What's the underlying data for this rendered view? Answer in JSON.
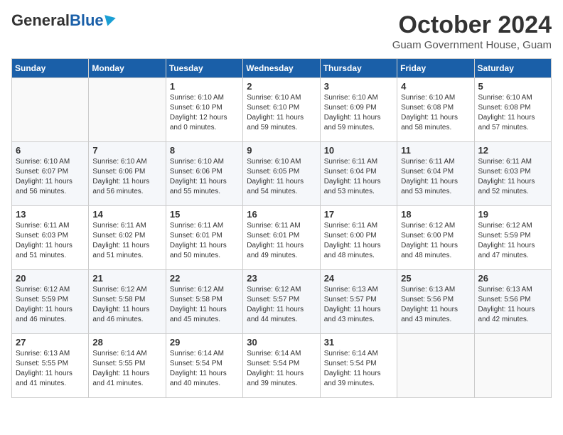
{
  "header": {
    "logo_general": "General",
    "logo_blue": "Blue",
    "month_title": "October 2024",
    "subtitle": "Guam Government House, Guam"
  },
  "weekdays": [
    "Sunday",
    "Monday",
    "Tuesday",
    "Wednesday",
    "Thursday",
    "Friday",
    "Saturday"
  ],
  "weeks": [
    [
      {
        "day": "",
        "info": ""
      },
      {
        "day": "",
        "info": ""
      },
      {
        "day": "1",
        "info": "Sunrise: 6:10 AM\nSunset: 6:10 PM\nDaylight: 12 hours\nand 0 minutes."
      },
      {
        "day": "2",
        "info": "Sunrise: 6:10 AM\nSunset: 6:10 PM\nDaylight: 11 hours\nand 59 minutes."
      },
      {
        "day": "3",
        "info": "Sunrise: 6:10 AM\nSunset: 6:09 PM\nDaylight: 11 hours\nand 59 minutes."
      },
      {
        "day": "4",
        "info": "Sunrise: 6:10 AM\nSunset: 6:08 PM\nDaylight: 11 hours\nand 58 minutes."
      },
      {
        "day": "5",
        "info": "Sunrise: 6:10 AM\nSunset: 6:08 PM\nDaylight: 11 hours\nand 57 minutes."
      }
    ],
    [
      {
        "day": "6",
        "info": "Sunrise: 6:10 AM\nSunset: 6:07 PM\nDaylight: 11 hours\nand 56 minutes."
      },
      {
        "day": "7",
        "info": "Sunrise: 6:10 AM\nSunset: 6:06 PM\nDaylight: 11 hours\nand 56 minutes."
      },
      {
        "day": "8",
        "info": "Sunrise: 6:10 AM\nSunset: 6:06 PM\nDaylight: 11 hours\nand 55 minutes."
      },
      {
        "day": "9",
        "info": "Sunrise: 6:10 AM\nSunset: 6:05 PM\nDaylight: 11 hours\nand 54 minutes."
      },
      {
        "day": "10",
        "info": "Sunrise: 6:11 AM\nSunset: 6:04 PM\nDaylight: 11 hours\nand 53 minutes."
      },
      {
        "day": "11",
        "info": "Sunrise: 6:11 AM\nSunset: 6:04 PM\nDaylight: 11 hours\nand 53 minutes."
      },
      {
        "day": "12",
        "info": "Sunrise: 6:11 AM\nSunset: 6:03 PM\nDaylight: 11 hours\nand 52 minutes."
      }
    ],
    [
      {
        "day": "13",
        "info": "Sunrise: 6:11 AM\nSunset: 6:03 PM\nDaylight: 11 hours\nand 51 minutes."
      },
      {
        "day": "14",
        "info": "Sunrise: 6:11 AM\nSunset: 6:02 PM\nDaylight: 11 hours\nand 51 minutes."
      },
      {
        "day": "15",
        "info": "Sunrise: 6:11 AM\nSunset: 6:01 PM\nDaylight: 11 hours\nand 50 minutes."
      },
      {
        "day": "16",
        "info": "Sunrise: 6:11 AM\nSunset: 6:01 PM\nDaylight: 11 hours\nand 49 minutes."
      },
      {
        "day": "17",
        "info": "Sunrise: 6:11 AM\nSunset: 6:00 PM\nDaylight: 11 hours\nand 48 minutes."
      },
      {
        "day": "18",
        "info": "Sunrise: 6:12 AM\nSunset: 6:00 PM\nDaylight: 11 hours\nand 48 minutes."
      },
      {
        "day": "19",
        "info": "Sunrise: 6:12 AM\nSunset: 5:59 PM\nDaylight: 11 hours\nand 47 minutes."
      }
    ],
    [
      {
        "day": "20",
        "info": "Sunrise: 6:12 AM\nSunset: 5:59 PM\nDaylight: 11 hours\nand 46 minutes."
      },
      {
        "day": "21",
        "info": "Sunrise: 6:12 AM\nSunset: 5:58 PM\nDaylight: 11 hours\nand 46 minutes."
      },
      {
        "day": "22",
        "info": "Sunrise: 6:12 AM\nSunset: 5:58 PM\nDaylight: 11 hours\nand 45 minutes."
      },
      {
        "day": "23",
        "info": "Sunrise: 6:12 AM\nSunset: 5:57 PM\nDaylight: 11 hours\nand 44 minutes."
      },
      {
        "day": "24",
        "info": "Sunrise: 6:13 AM\nSunset: 5:57 PM\nDaylight: 11 hours\nand 43 minutes."
      },
      {
        "day": "25",
        "info": "Sunrise: 6:13 AM\nSunset: 5:56 PM\nDaylight: 11 hours\nand 43 minutes."
      },
      {
        "day": "26",
        "info": "Sunrise: 6:13 AM\nSunset: 5:56 PM\nDaylight: 11 hours\nand 42 minutes."
      }
    ],
    [
      {
        "day": "27",
        "info": "Sunrise: 6:13 AM\nSunset: 5:55 PM\nDaylight: 11 hours\nand 41 minutes."
      },
      {
        "day": "28",
        "info": "Sunrise: 6:14 AM\nSunset: 5:55 PM\nDaylight: 11 hours\nand 41 minutes."
      },
      {
        "day": "29",
        "info": "Sunrise: 6:14 AM\nSunset: 5:54 PM\nDaylight: 11 hours\nand 40 minutes."
      },
      {
        "day": "30",
        "info": "Sunrise: 6:14 AM\nSunset: 5:54 PM\nDaylight: 11 hours\nand 39 minutes."
      },
      {
        "day": "31",
        "info": "Sunrise: 6:14 AM\nSunset: 5:54 PM\nDaylight: 11 hours\nand 39 minutes."
      },
      {
        "day": "",
        "info": ""
      },
      {
        "day": "",
        "info": ""
      }
    ]
  ]
}
